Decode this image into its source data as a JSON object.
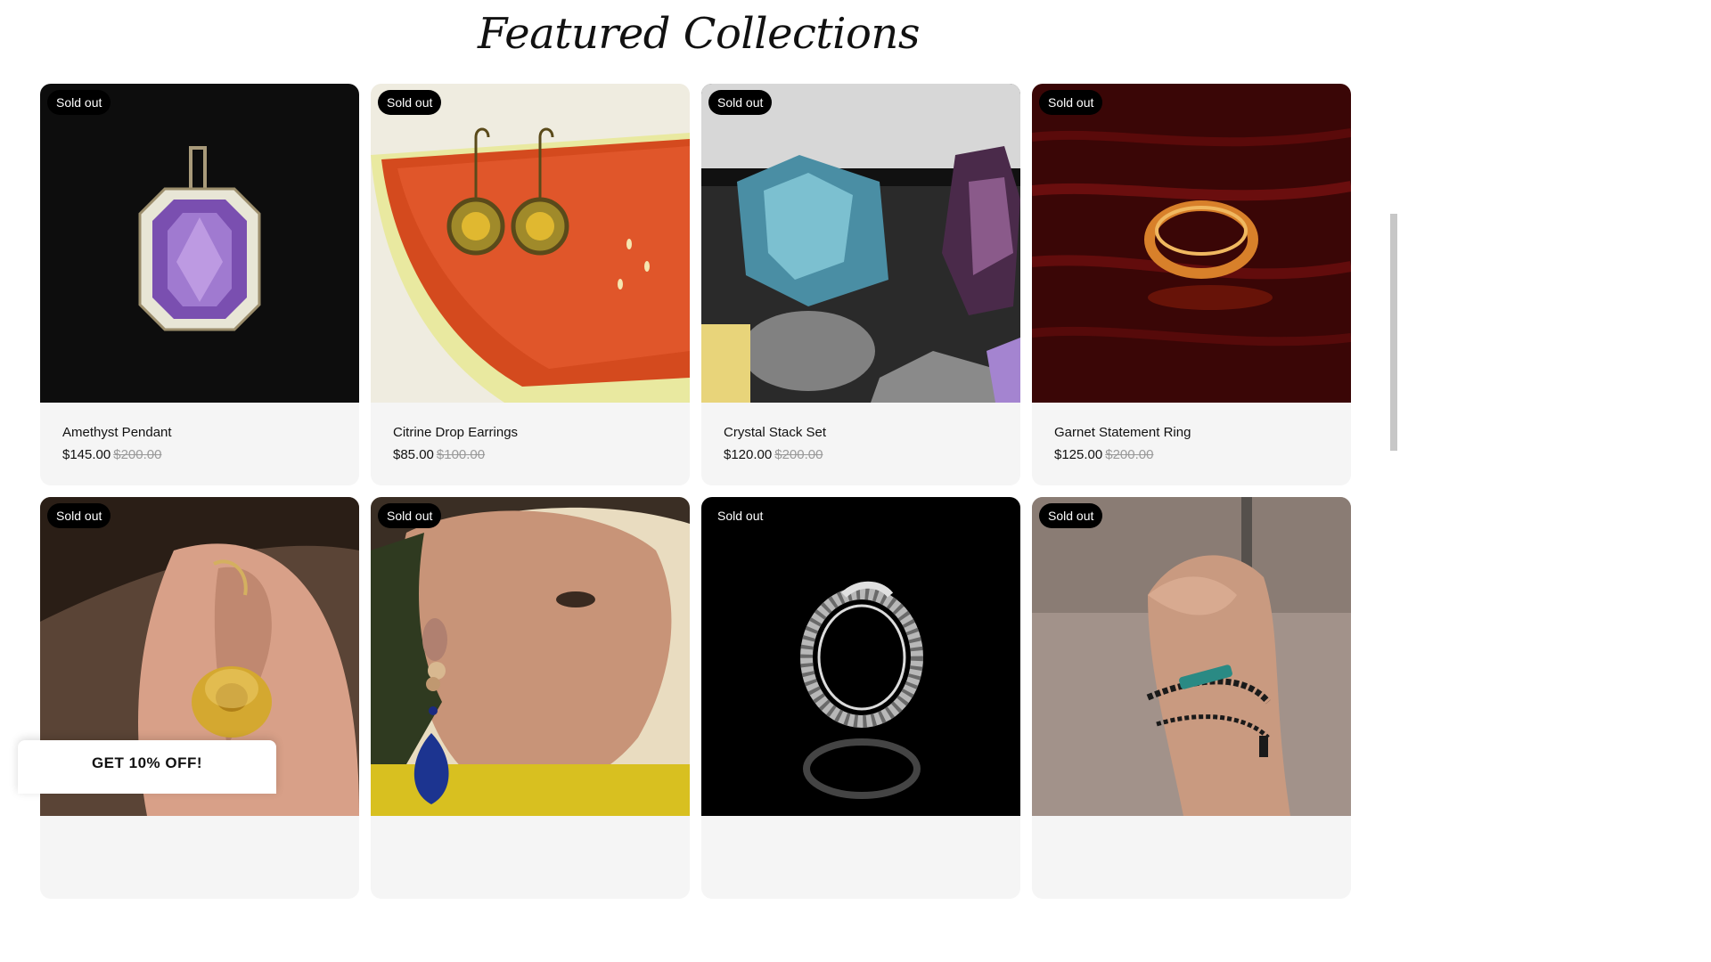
{
  "header": {
    "title": "Featured Collections"
  },
  "badge_label": "Sold out",
  "products": [
    {
      "name": "Amethyst Pendant",
      "price": "$145.00",
      "compare_price": "$200.00",
      "image": "amethyst-pendant-photo"
    },
    {
      "name": "Citrine Drop Earrings",
      "price": "$85.00",
      "compare_price": "$100.00",
      "image": "earrings-on-watermelon-photo"
    },
    {
      "name": "Crystal Stack Set",
      "price": "$120.00",
      "compare_price": "$200.00",
      "image": "crystal-cluster-photo"
    },
    {
      "name": "Garnet Statement Ring",
      "price": "$125.00",
      "compare_price": "$200.00",
      "image": "gold-ring-on-wood-photo"
    },
    {
      "image": "gold-hoop-earring-photo"
    },
    {
      "image": "woman-blue-drop-earring-photo"
    },
    {
      "image": "silver-snake-ring-photo"
    },
    {
      "image": "beaded-bracelet-wrist-photo"
    }
  ],
  "promo": {
    "label": "GET 10% OFF!"
  }
}
